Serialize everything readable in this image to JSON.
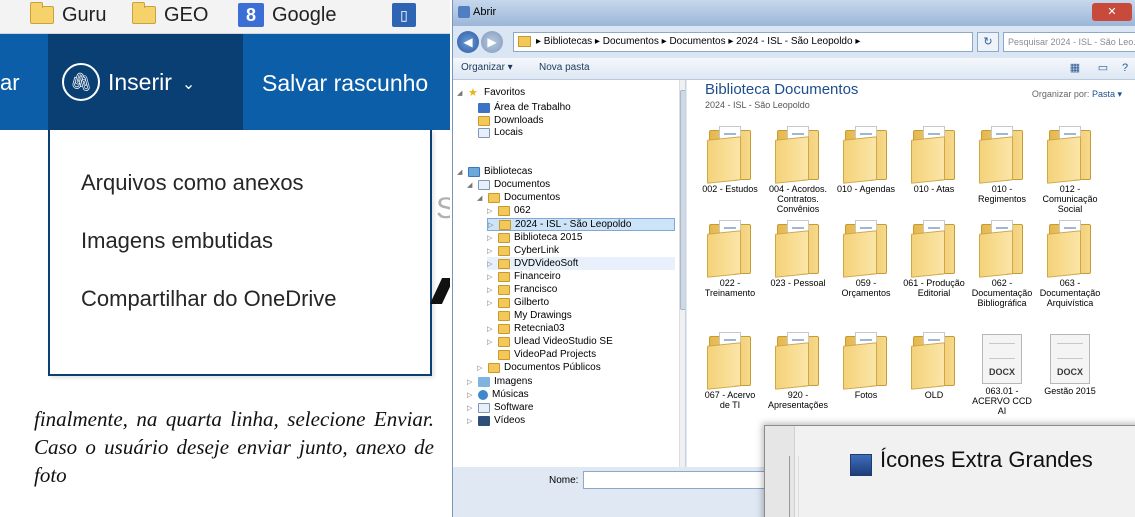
{
  "bookmarks": [
    {
      "label": "Guru",
      "icon": "folder-icon"
    },
    {
      "label": "GEO",
      "icon": "folder-icon"
    },
    {
      "label": "Google",
      "icon": "google-icon"
    }
  ],
  "command_bar": {
    "left_partial": "ar",
    "insert_label": "Inserir",
    "save_draft": "Salvar rascunho"
  },
  "insert_menu": {
    "items": [
      "Arquivos como anexos",
      "Imagens embutidas",
      "Compartilhar do OneDrive"
    ]
  },
  "document_text": "finalmente, na quarta linha, selecione Enviar. Caso o usuário deseje enviar junto, anexo de foto",
  "dialog": {
    "title": "Abrir",
    "address": "▸ Bibliotecas ▸ Documentos ▸ Documentos ▸ 2024 - ISL - São Leopoldo ▸",
    "search_placeholder": "Pesquisar 2024 - ISL - São Leo...",
    "toolbar": {
      "organize": "Organizar ▾",
      "new_folder": "Nova pasta"
    },
    "nav": [
      {
        "label": "Favoritos",
        "indent": 0,
        "icon": "star",
        "tri": "◢"
      },
      {
        "label": "Área de Trabalho",
        "indent": 1,
        "icon": "blue"
      },
      {
        "label": "Downloads",
        "indent": 1,
        "icon": "fold"
      },
      {
        "label": "Locais",
        "indent": 1,
        "icon": "doc"
      },
      {
        "label": "Bibliotecas",
        "indent": 0,
        "icon": "lib",
        "tri": "◢"
      },
      {
        "label": "Documentos",
        "indent": 1,
        "icon": "doc",
        "tri": "◢"
      },
      {
        "label": "Documentos",
        "indent": 2,
        "icon": "fold",
        "tri": "◢"
      },
      {
        "label": "062",
        "indent": 3,
        "icon": "fold",
        "tri": "▷"
      },
      {
        "label": "2024 - ISL - São Leopoldo",
        "indent": 3,
        "icon": "fold",
        "tri": "▷",
        "state": "selected"
      },
      {
        "label": "Biblioteca 2015",
        "indent": 3,
        "icon": "fold",
        "tri": "▷"
      },
      {
        "label": "CyberLink",
        "indent": 3,
        "icon": "fold",
        "tri": "▷"
      },
      {
        "label": "DVDVideoSoft",
        "indent": 3,
        "icon": "fold",
        "tri": "▷",
        "state": "hover"
      },
      {
        "label": "Financeiro",
        "indent": 3,
        "icon": "fold",
        "tri": "▷"
      },
      {
        "label": "Francisco",
        "indent": 3,
        "icon": "fold",
        "tri": "▷"
      },
      {
        "label": "Gilberto",
        "indent": 3,
        "icon": "fold",
        "tri": "▷"
      },
      {
        "label": "My Drawings",
        "indent": 3,
        "icon": "fold"
      },
      {
        "label": "Retecnia03",
        "indent": 3,
        "icon": "fold",
        "tri": "▷"
      },
      {
        "label": "Ulead VideoStudio SE",
        "indent": 3,
        "icon": "fold",
        "tri": "▷"
      },
      {
        "label": "VideoPad Projects",
        "indent": 3,
        "icon": "fold"
      },
      {
        "label": "Documentos Públicos",
        "indent": 2,
        "icon": "fold",
        "tri": "▷"
      },
      {
        "label": "Imagens",
        "indent": 1,
        "icon": "img",
        "tri": "▷"
      },
      {
        "label": "Músicas",
        "indent": 1,
        "icon": "mus",
        "tri": "▷"
      },
      {
        "label": "Software",
        "indent": 1,
        "icon": "doc",
        "tri": "▷"
      },
      {
        "label": "Vídeos",
        "indent": 1,
        "icon": "vid",
        "tri": "▷"
      }
    ],
    "library_title": "Biblioteca Documentos",
    "library_subtitle": "2024 - ISL - São Leopoldo",
    "arrange_label": "Organizar por:",
    "arrange_value": "Pasta ▾",
    "items": [
      {
        "label": "002 - Estudos",
        "type": "folder"
      },
      {
        "label": "004 - Acordos. Contratos. Convênios",
        "type": "folder"
      },
      {
        "label": "010 - Agendas",
        "type": "folder"
      },
      {
        "label": "010 - Atas",
        "type": "folder"
      },
      {
        "label": "010 - Regimentos",
        "type": "folder"
      },
      {
        "label": "012 - Comunicação Social",
        "type": "folder"
      },
      {
        "label": "022 - Treinamento",
        "type": "folder"
      },
      {
        "label": "023 - Pessoal",
        "type": "folder"
      },
      {
        "label": "059 - Orçamentos",
        "type": "folder"
      },
      {
        "label": "061 - Produção Editorial",
        "type": "folder"
      },
      {
        "label": "062 - Documentação Bibliográfica",
        "type": "folder"
      },
      {
        "label": "063 - Documentação Arquivística",
        "type": "folder"
      },
      {
        "label": "067 - Acervo de TI",
        "type": "folder"
      },
      {
        "label": "920 - Apresentações",
        "type": "folder"
      },
      {
        "label": "Fotos",
        "type": "folder"
      },
      {
        "label": "OLD",
        "type": "folder"
      },
      {
        "label": "063.01 - ACERVO CCD AI",
        "type": "docx"
      },
      {
        "label": "Gestão 2015",
        "type": "docx"
      }
    ],
    "docx_badge": "DOCX",
    "name_label": "Nome:",
    "view_popup_label": "Ícones Extra Grandes"
  }
}
